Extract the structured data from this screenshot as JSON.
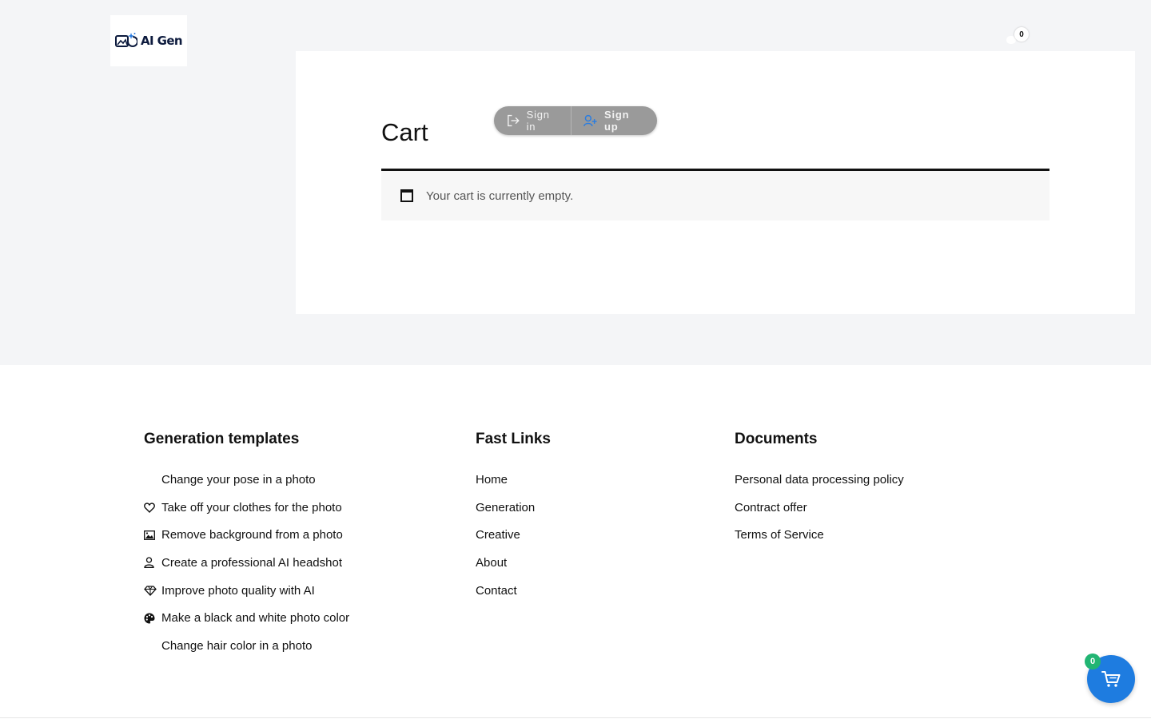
{
  "header": {
    "logo_text": "AI Gen",
    "cart_count": "0"
  },
  "auth": {
    "signin_label": "Sign in",
    "signup_label": "Sign up"
  },
  "cart": {
    "title": "Cart",
    "empty_message": "Your cart is currently empty."
  },
  "footer": {
    "templates": {
      "heading": "Generation templates",
      "items": [
        {
          "label": "Change your pose in a photo",
          "icon": ""
        },
        {
          "label": "Take off your clothes for the photo",
          "icon": "heart-icon"
        },
        {
          "label": "Remove background from a photo",
          "icon": "image-icon"
        },
        {
          "label": "Create a professional AI headshot",
          "icon": "user-icon"
        },
        {
          "label": "Improve photo quality with AI",
          "icon": "diamond-icon"
        },
        {
          "label": "Make a black and white photo color",
          "icon": "palette-icon"
        },
        {
          "label": "Change hair color in a photo",
          "icon": ""
        }
      ]
    },
    "fast_links": {
      "heading": "Fast Links",
      "items": [
        "Home",
        "Generation",
        "Creative",
        "About",
        "Contact"
      ]
    },
    "documents": {
      "heading": "Documents",
      "items": [
        "Personal data processing policy",
        "Contract offer",
        "Terms of Service"
      ]
    }
  },
  "floating_cart": {
    "count": "0"
  },
  "colors": {
    "page_bg": "#f4f5f7",
    "accent_blue": "#1e7ce0",
    "badge_green": "#22b573",
    "pill_gray": "#9a9a9a"
  }
}
